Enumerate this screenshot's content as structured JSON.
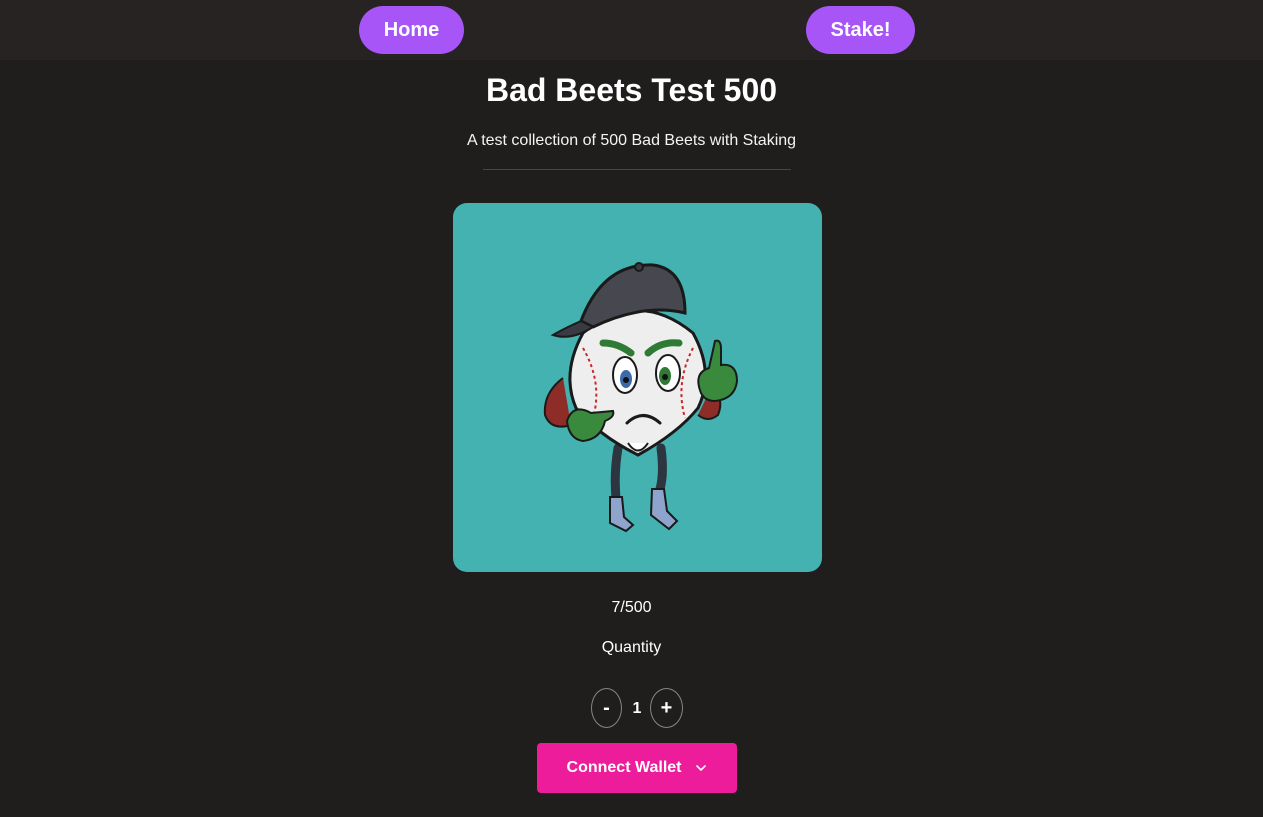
{
  "nav": {
    "home_label": "Home",
    "stake_label": "Stake!"
  },
  "collection": {
    "title": "Bad Beets Test 500",
    "description": "A test collection of 500 Bad Beets with Staking"
  },
  "mint": {
    "supply": "7/500",
    "quantity_label": "Quantity",
    "quantity_value": "1",
    "decrement_label": "-",
    "increment_label": "+",
    "connect_label": "Connect Wallet",
    "connect_icon": "chevron-down-icon"
  },
  "image": {
    "icon": "baseball-beet-character",
    "background_color": "#43b2b1"
  },
  "colors": {
    "page_bg": "#201d1d",
    "topbar_bg": "#272323",
    "nav_button": "#a855f7",
    "connect_button": "#ec1c9b"
  }
}
